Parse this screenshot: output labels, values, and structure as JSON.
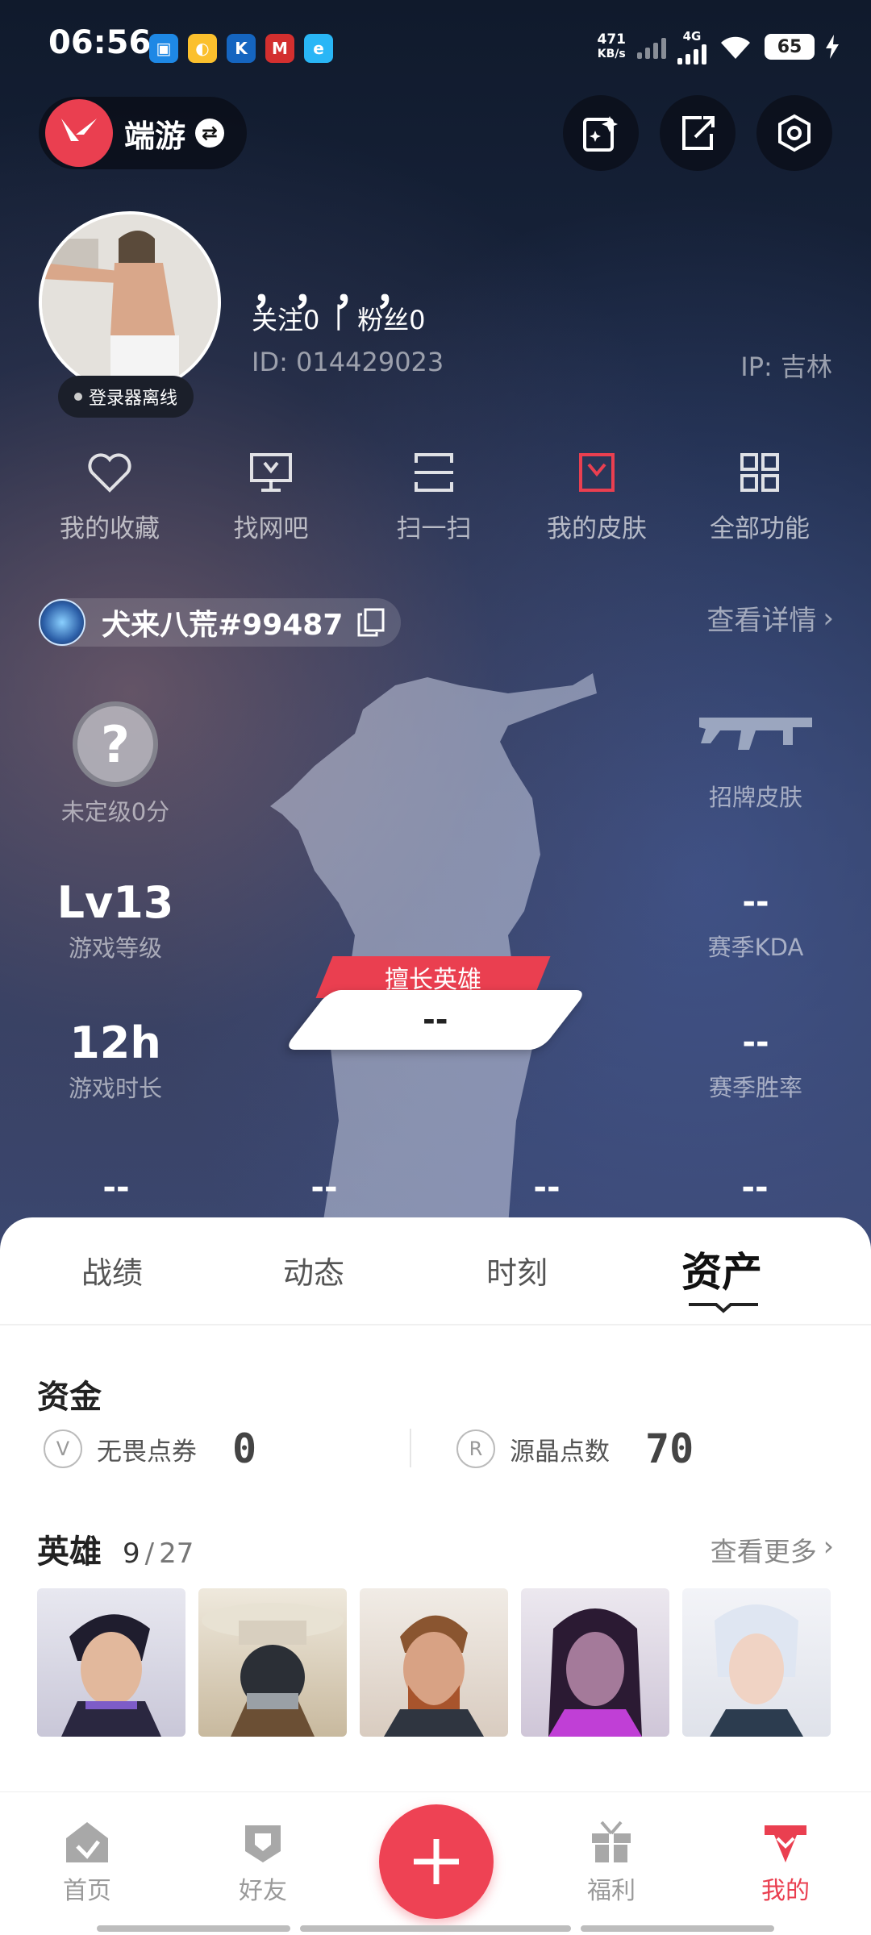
{
  "status_bar": {
    "time": "06:56",
    "net_speed_top": "471",
    "net_speed_unit": "KB/s",
    "network": "4G",
    "battery": "65"
  },
  "header": {
    "app_name": "端游"
  },
  "profile": {
    "nickname": "，，，，",
    "follow_label": "关注0",
    "separator": "|",
    "fans_label": "粉丝0",
    "id_text": "ID:  014429023",
    "ip_text": "IP:  吉林",
    "offline_label": "登录器离线"
  },
  "quick_functions": [
    {
      "label": "我的收藏",
      "icon": "heart-icon"
    },
    {
      "label": "找网吧",
      "icon": "monitor-icon"
    },
    {
      "label": "扫一扫",
      "icon": "scan-icon"
    },
    {
      "label": "我的皮肤",
      "icon": "skin-icon"
    },
    {
      "label": "全部功能",
      "icon": "grid-icon"
    }
  ],
  "player": {
    "name": "犬来八荒#99487",
    "detail_link": "查看详情",
    "rank_label": "未定级0分",
    "signature_skin_label": "招牌皮肤",
    "level_value": "Lv13",
    "level_label": "游戏等级",
    "kda_value": "--",
    "kda_label": "赛季KDA",
    "hours_value": "12h",
    "hours_label": "游戏时长",
    "winrate_value": "--",
    "winrate_label": "赛季胜率",
    "best_hero_label": "擅长英雄",
    "best_hero_value": "--",
    "bottom_stats": [
      "--",
      "--",
      "--",
      "--"
    ]
  },
  "tabs": [
    {
      "label": "战绩"
    },
    {
      "label": "动态"
    },
    {
      "label": "时刻"
    },
    {
      "label": "资产",
      "active": true
    }
  ],
  "assets": {
    "funds_title": "资金",
    "funds": [
      {
        "label": "无畏点券",
        "value": "0"
      },
      {
        "label": "源晶点数",
        "value": "70"
      }
    ],
    "heroes_title": "英雄",
    "heroes_owned": "9",
    "heroes_sep": "/",
    "heroes_total": "27",
    "heroes_more": "查看更多"
  },
  "bottom_nav": [
    {
      "label": "首页"
    },
    {
      "label": "好友"
    },
    {
      "label": "福利"
    },
    {
      "label": "我的",
      "active": true
    }
  ],
  "colors": {
    "accent": "#ea3f50"
  }
}
